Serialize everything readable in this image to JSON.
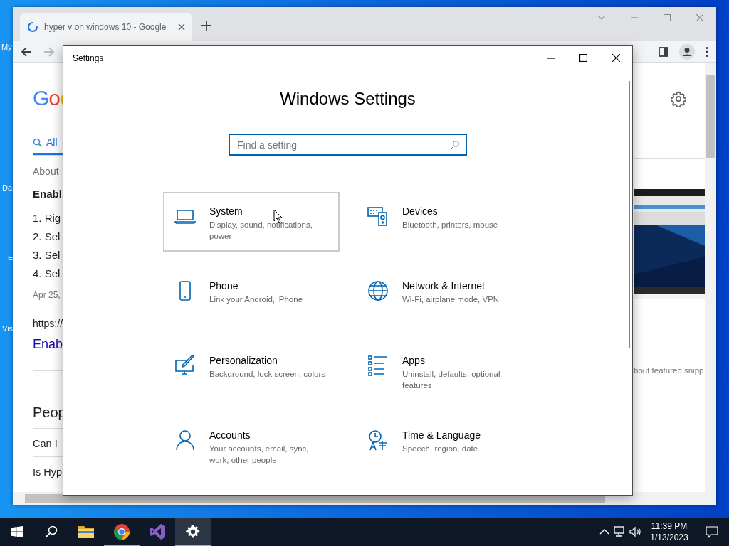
{
  "desktop": {
    "icon_labels": [
      "My",
      "Da",
      "E",
      "Vis"
    ]
  },
  "browser": {
    "tabs": [
      {
        "title": "hyper v on windows 10 - Google",
        "loading": true,
        "selected": true
      }
    ],
    "page": {
      "logo": "Goo",
      "search_tabs": [
        {
          "label": "All",
          "selected": true
        }
      ],
      "about": "About",
      "snippet_title": "Enabl",
      "steps": [
        "1. Rig",
        "2. Sel",
        "3. Sel",
        "4. Sel"
      ],
      "date": "Apr 25,",
      "url": "https://",
      "result_link": "Enab",
      "people_heading": "Peop",
      "questions": [
        "Can I",
        "Is Hyp"
      ],
      "snippet_note": "bout featured snipp"
    }
  },
  "settings": {
    "title": "Settings",
    "heading": "Windows Settings",
    "search": {
      "placeholder": "Find a setting"
    },
    "categories": [
      {
        "title": "System",
        "description": "Display, sound, notifications, power",
        "selected": true
      },
      {
        "title": "Devices",
        "description": "Bluetooth, printers, mouse",
        "selected": false
      },
      {
        "title": "Phone",
        "description": "Link your Android, iPhone",
        "selected": false
      },
      {
        "title": "Network & Internet",
        "description": "Wi-Fi, airplane mode, VPN",
        "selected": false
      },
      {
        "title": "Personalization",
        "description": "Background, lock screen, colors",
        "selected": false
      },
      {
        "title": "Apps",
        "description": "Uninstall, defaults, optional features",
        "selected": false
      },
      {
        "title": "Accounts",
        "description": "Your accounts, email, sync, work, other people",
        "selected": false
      },
      {
        "title": "Time & Language",
        "description": "Speech, region, date",
        "selected": false
      }
    ]
  },
  "taskbar": {
    "apps": [
      {
        "running": false,
        "selected": false
      },
      {
        "running": true,
        "selected": false
      },
      {
        "running": false,
        "selected": false
      },
      {
        "running": true,
        "selected": true
      }
    ],
    "time": "11:39 PM",
    "date": "1/13/2023"
  }
}
